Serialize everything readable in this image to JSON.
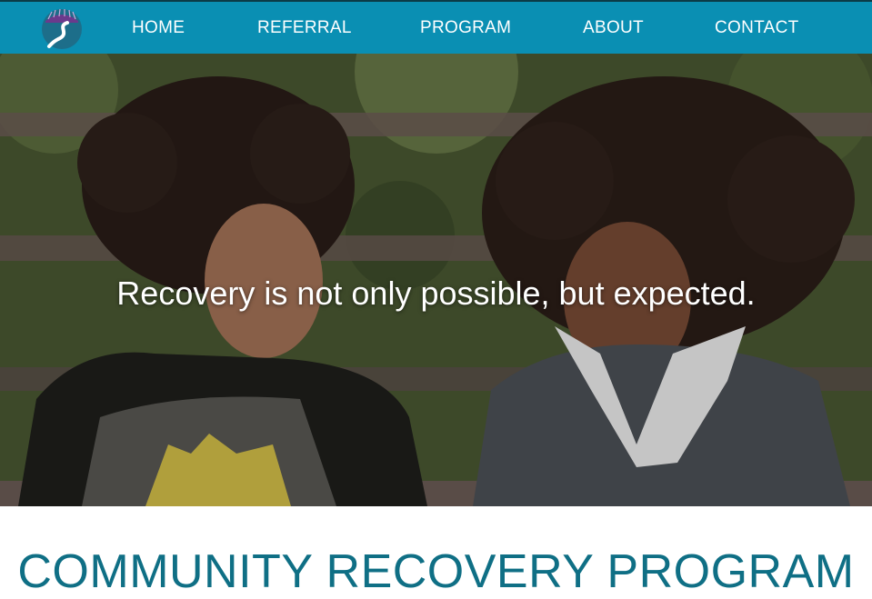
{
  "nav": {
    "items": [
      {
        "label": "HOME"
      },
      {
        "label": "REFERRAL"
      },
      {
        "label": "PROGRAM"
      },
      {
        "label": "ABOUT"
      },
      {
        "label": "CONTACT"
      }
    ],
    "logo_icon": "winding-road-logo-icon"
  },
  "hero": {
    "heading": "Recovery is not only possible, but expected.",
    "image": "two-smiling-teens-photo"
  },
  "section": {
    "title": "COMMUNITY RECOVERY PROGRAM"
  },
  "colors": {
    "nav_bg": "#0a8fb3",
    "title_color": "#0f6f85",
    "logo_purple": "#6b3a8c"
  }
}
